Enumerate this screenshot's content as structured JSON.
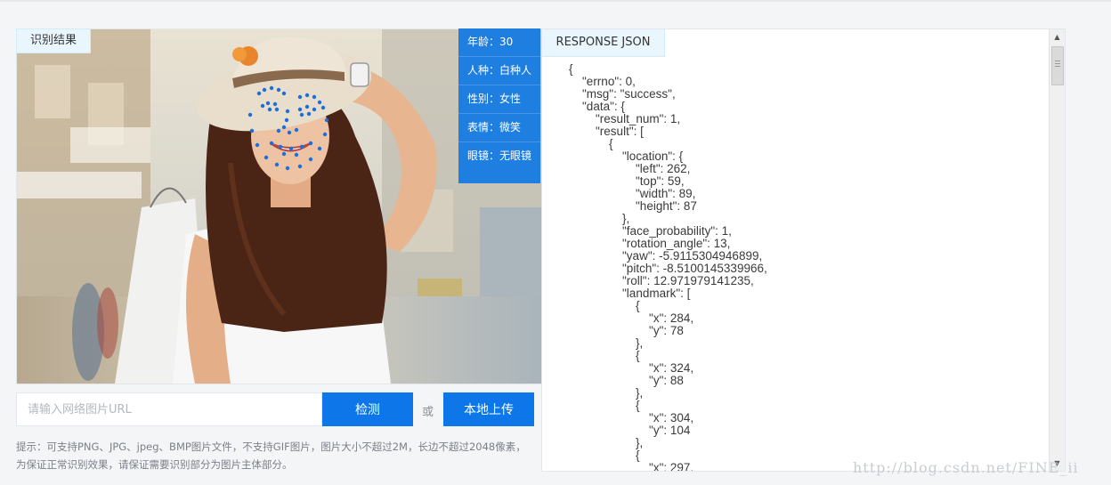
{
  "demo": {
    "result_tab": "识别结果",
    "attributes": [
      {
        "label": "年龄",
        "value": "30"
      },
      {
        "label": "人种",
        "value": "白种人"
      },
      {
        "label": "性别",
        "value": "女性"
      },
      {
        "label": "表情",
        "value": "微笑"
      },
      {
        "label": "眼镜",
        "value": "无眼镜"
      }
    ],
    "url_placeholder": "请输入网络图片URL",
    "detect_button": "检测",
    "or_text": "或",
    "upload_button": "本地上传",
    "hint_lines": [
      "提示：可支持PNG、JPG、jpeg、BMP图片文件，不支持GIF图片，图片大小不超过2M，长边不超过2048像素，",
      "为保证正常识别效果，请保证需要识别部分为图片主体部分。"
    ]
  },
  "json_panel": {
    "tab_label": "RESPONSE JSON",
    "json_text": "{\n\t\"errno\": 0,\n\t\"msg\": \"success\",\n\t\"data\": {\n\t\t\"result_num\": 1,\n\t\t\"result\": [\n\t\t\t{\n\t\t\t\t\"location\": {\n\t\t\t\t\t\"left\": 262,\n\t\t\t\t\t\"top\": 59,\n\t\t\t\t\t\"width\": 89,\n\t\t\t\t\t\"height\": 87\n\t\t\t\t},\n\t\t\t\t\"face_probability\": 1,\n\t\t\t\t\"rotation_angle\": 13,\n\t\t\t\t\"yaw\": -5.9115304946899,\n\t\t\t\t\"pitch\": -8.5100145339966,\n\t\t\t\t\"roll\": 12.971979141235,\n\t\t\t\t\"landmark\": [\n\t\t\t\t\t{\n\t\t\t\t\t\t\"x\": 284,\n\t\t\t\t\t\t\"y\": 78\n\t\t\t\t\t},\n\t\t\t\t\t{\n\t\t\t\t\t\t\"x\": 324,\n\t\t\t\t\t\t\"y\": 88\n\t\t\t\t\t},\n\t\t\t\t\t{\n\t\t\t\t\t\t\"x\": 304,\n\t\t\t\t\t\t\"y\": 104\n\t\t\t\t\t},\n\t\t\t\t\t{\n\t\t\t\t\t\t\"x\": 297,"
  },
  "watermark": "http://blog.csdn.net/FINE_ii",
  "colors": {
    "accent": "#0d76e8",
    "attr_bg": "#1f7fe0",
    "tab_bg": "#eaf6fe",
    "landmark_dot": "#1a6fe0"
  },
  "icons": {
    "scroll_up": "▲",
    "scroll_down": "▼"
  }
}
